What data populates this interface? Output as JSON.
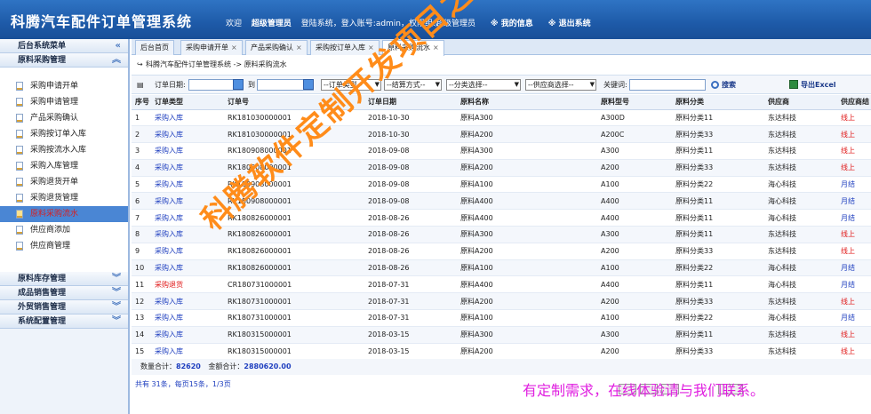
{
  "header": {
    "app_title": "科腾汽车配件订单管理系统",
    "welcome": "欢迎",
    "user_role": "超级管理员",
    "login_text": "登陆系统，登入账号:admin，权限组:超级管理员",
    "my_info": "※ 我的信息",
    "logout": "※ 退出系统"
  },
  "sidebar": {
    "title": "后台系统菜单",
    "groups": [
      {
        "label": "原料采购管理",
        "expanded": true,
        "items": [
          {
            "label": "采购申请开单"
          },
          {
            "label": "采购申请管理"
          },
          {
            "label": "产品采购确认"
          },
          {
            "label": "采购按订单入库"
          },
          {
            "label": "采购按流水入库"
          },
          {
            "label": "采购入库管理"
          },
          {
            "label": "采购退货开单"
          },
          {
            "label": "采购退货管理"
          },
          {
            "label": "原料采购流水",
            "active": true
          },
          {
            "label": "供应商添加"
          },
          {
            "label": "供应商管理"
          }
        ]
      },
      {
        "label": "原料库存管理",
        "expanded": false
      },
      {
        "label": "成品销售管理",
        "expanded": false
      },
      {
        "label": "外贸销售管理",
        "expanded": false
      },
      {
        "label": "系统配置管理",
        "expanded": false
      }
    ]
  },
  "tabs": [
    {
      "label": "后台首页",
      "closable": false
    },
    {
      "label": "采购申请开单",
      "closable": true
    },
    {
      "label": "产品采购确认",
      "closable": true
    },
    {
      "label": "采购按订单入库",
      "closable": true
    },
    {
      "label": "原料采购流水",
      "closable": true,
      "active": true
    }
  ],
  "breadcrumb": "科腾汽车配件订单管理系统 -> 原料采购流水",
  "filter": {
    "order_date_label": "订单日期:",
    "to_label": "到",
    "order_type": "--订单类型--",
    "settle_type": "--结算方式--",
    "category": "--分类选择--",
    "supplier": "--供应商选择--",
    "keyword_label": "关键词:",
    "search_label": "搜索",
    "export_label": "导出Excel"
  },
  "table": {
    "columns": [
      "序号",
      "订单类型",
      "订单号",
      "订单日期",
      "原料名称",
      "原料型号",
      "原料分类",
      "供应商",
      "供应商结"
    ],
    "rows": [
      [
        "1",
        "采购入库",
        "RK181030000001",
        "2018-10-30",
        "原料A300",
        "A300D",
        "原料分类11",
        "东达科技",
        "线上"
      ],
      [
        "2",
        "采购入库",
        "RK181030000001",
        "2018-10-30",
        "原料A200",
        "A200C",
        "原料分类33",
        "东达科技",
        "线上"
      ],
      [
        "3",
        "采购入库",
        "RK180908000001",
        "2018-09-08",
        "原料A300",
        "A300",
        "原料分类11",
        "东达科技",
        "线上"
      ],
      [
        "4",
        "采购入库",
        "RK180908000001",
        "2018-09-08",
        "原料A200",
        "A200",
        "原料分类33",
        "东达科技",
        "线上"
      ],
      [
        "5",
        "采购入库",
        "RK180908000001",
        "2018-09-08",
        "原料A100",
        "A100",
        "原料分类22",
        "海心科技",
        "月结"
      ],
      [
        "6",
        "采购入库",
        "RK180908000001",
        "2018-09-08",
        "原料A400",
        "A400",
        "原料分类11",
        "海心科技",
        "月结"
      ],
      [
        "7",
        "采购入库",
        "RK180826000001",
        "2018-08-26",
        "原料A400",
        "A400",
        "原料分类11",
        "海心科技",
        "月结"
      ],
      [
        "8",
        "采购入库",
        "RK180826000001",
        "2018-08-26",
        "原料A300",
        "A300",
        "原料分类11",
        "东达科技",
        "线上"
      ],
      [
        "9",
        "采购入库",
        "RK180826000001",
        "2018-08-26",
        "原料A200",
        "A200",
        "原料分类33",
        "东达科技",
        "线上"
      ],
      [
        "10",
        "采购入库",
        "RK180826000001",
        "2018-08-26",
        "原料A100",
        "A100",
        "原料分类22",
        "海心科技",
        "月结"
      ],
      [
        "11",
        "采购退货",
        "CR180731000001",
        "2018-07-31",
        "原料A400",
        "A400",
        "原料分类11",
        "海心科技",
        "月结"
      ],
      [
        "12",
        "采购入库",
        "RK180731000001",
        "2018-07-31",
        "原料A200",
        "A200",
        "原料分类33",
        "东达科技",
        "线上"
      ],
      [
        "13",
        "采购入库",
        "RK180731000001",
        "2018-07-31",
        "原料A100",
        "A100",
        "原料分类22",
        "海心科技",
        "月结"
      ],
      [
        "14",
        "采购入库",
        "RK180315000001",
        "2018-03-15",
        "原料A300",
        "A300",
        "原料分类11",
        "东达科技",
        "线上"
      ],
      [
        "15",
        "采购入库",
        "RK180315000001",
        "2018-03-15",
        "原料A200",
        "A200",
        "原料分类33",
        "东达科技",
        "线上"
      ]
    ]
  },
  "summary": {
    "qty_label": "数量合计：",
    "qty_value": "82620",
    "amount_label": "金额合计：",
    "amount_value": "2880620.00"
  },
  "pager": "共有 31条，每页15条，1/3页",
  "watermark": "科腾软件定制开发项目之一",
  "promo": "有定制需求，在线体验请与我们联系。",
  "colors": {
    "header_bg": "#1e5aa8",
    "accent_blue": "#1f3fbf",
    "alert_red": "#e01818",
    "active_item": "#4a86d4",
    "watermark": "#ff8c1a",
    "promo": "#e020e0"
  }
}
